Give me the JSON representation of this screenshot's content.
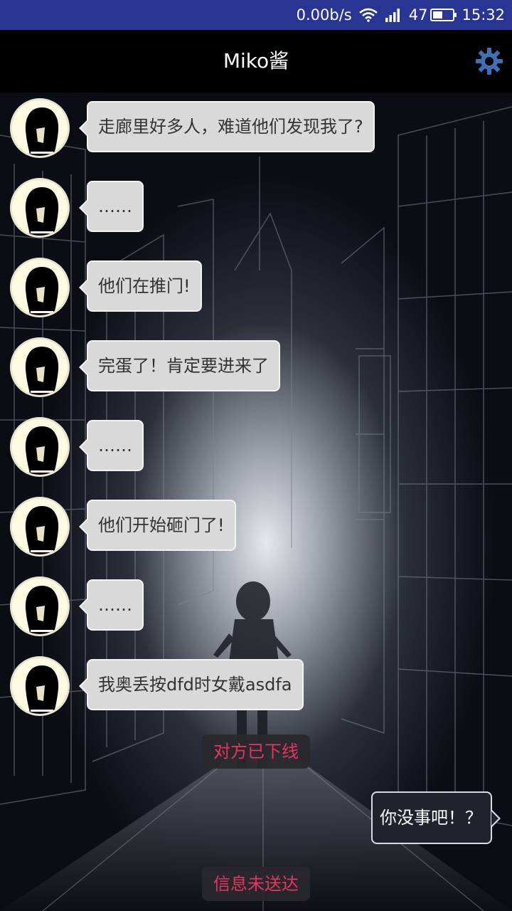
{
  "status_bar": {
    "net_speed": "0.00b/s",
    "wifi_icon": "wifi-icon",
    "signal_icon": "signal-icon",
    "battery_level": "47",
    "battery_fraction": 0.47,
    "time": "15:32"
  },
  "header": {
    "title": "Miko酱",
    "settings_icon": "gear-icon"
  },
  "messages": [
    {
      "text": "走廊里好多人，难道他们发现我了?"
    },
    {
      "text": "……"
    },
    {
      "text": "他们在推门!"
    },
    {
      "text": "完蛋了！肯定要进来了"
    },
    {
      "text": "……"
    },
    {
      "text": "他们开始砸门了!"
    },
    {
      "text": "……"
    },
    {
      "text": "我奥丢按dfd时女戴asdfa"
    }
  ],
  "notices": {
    "offline": "对方已下线",
    "not_delivered": "信息未送达"
  },
  "outgoing": {
    "text": "你没事吧！？"
  },
  "colors": {
    "status_bar": "#283593",
    "header_bg": "#000000",
    "gear": "#3f6fb5",
    "notice_text": "#e53562",
    "bubble_bg": "#d9d9d9",
    "avatar_bg": "#fffbe2"
  }
}
